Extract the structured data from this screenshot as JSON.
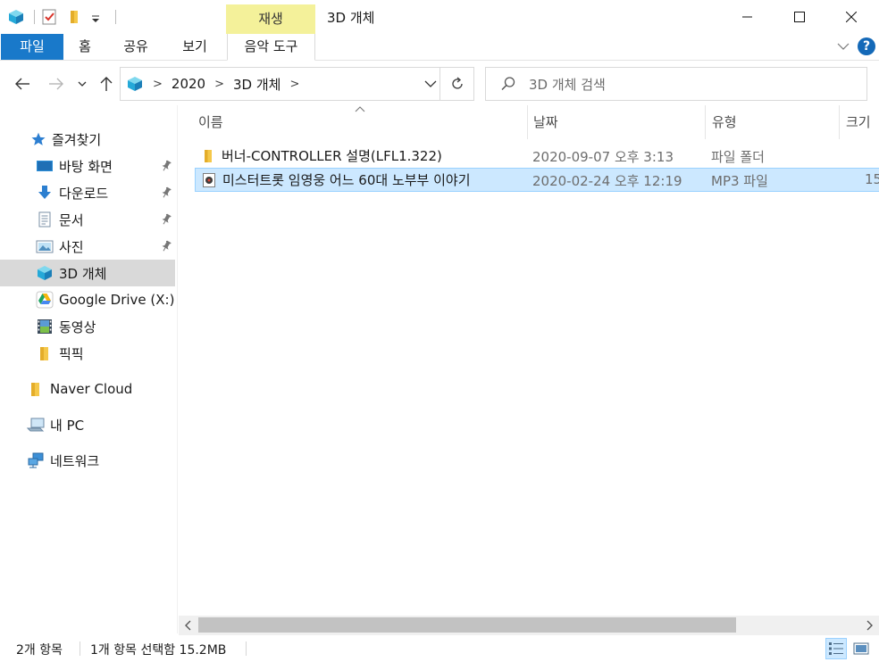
{
  "window": {
    "title": "3D 개체",
    "contextual_tab_group": "재생"
  },
  "ribbon": {
    "tabs": [
      {
        "label": "파일"
      },
      {
        "label": "홈"
      },
      {
        "label": "공유"
      },
      {
        "label": "보기"
      },
      {
        "label": "음악 도구"
      }
    ]
  },
  "address": {
    "crumbs": [
      "2020",
      "3D 개체"
    ]
  },
  "search": {
    "placeholder": "3D 개체 검색"
  },
  "nav": {
    "quick_access": "즐겨찾기",
    "items": [
      {
        "label": "바탕 화면",
        "icon": "desktop-icon",
        "pinned": true
      },
      {
        "label": "다운로드",
        "icon": "download-icon",
        "pinned": true
      },
      {
        "label": "문서",
        "icon": "document-icon",
        "pinned": true
      },
      {
        "label": "사진",
        "icon": "pictures-icon",
        "pinned": true
      },
      {
        "label": "3D 개체",
        "icon": "3d-objects-icon",
        "selected": true
      },
      {
        "label": "Google Drive (X:)",
        "icon": "google-drive-icon"
      },
      {
        "label": "동영상",
        "icon": "videos-icon"
      },
      {
        "label": "픽픽",
        "icon": "folder-icon"
      }
    ],
    "naver_cloud": "Naver Cloud",
    "this_pc": "내 PC",
    "network": "네트워크"
  },
  "columns": {
    "name": "이름",
    "date": "날짜",
    "type": "유형",
    "size": "크기"
  },
  "files": [
    {
      "name": "버너-CONTROLLER 설명(LFL1.322)",
      "date": "2020-09-07 오후 3:13",
      "type": "파일 폴더",
      "size": "",
      "icon": "folder-icon",
      "selected": false
    },
    {
      "name": "미스터트롯 임영웅 어느 60대 노부부 이야기",
      "date": "2020-02-24 오후 12:19",
      "type": "MP3 파일",
      "size": "15",
      "icon": "mp3-file-icon",
      "selected": true
    }
  ],
  "status": {
    "item_count": "2개 항목",
    "selection": "1개 항목 선택함 15.2MB"
  },
  "colors": {
    "accent": "#1979ca",
    "selection_bg": "#cce8ff",
    "selection_border": "#99d1ff",
    "contextual_tab": "#f4f19a"
  }
}
